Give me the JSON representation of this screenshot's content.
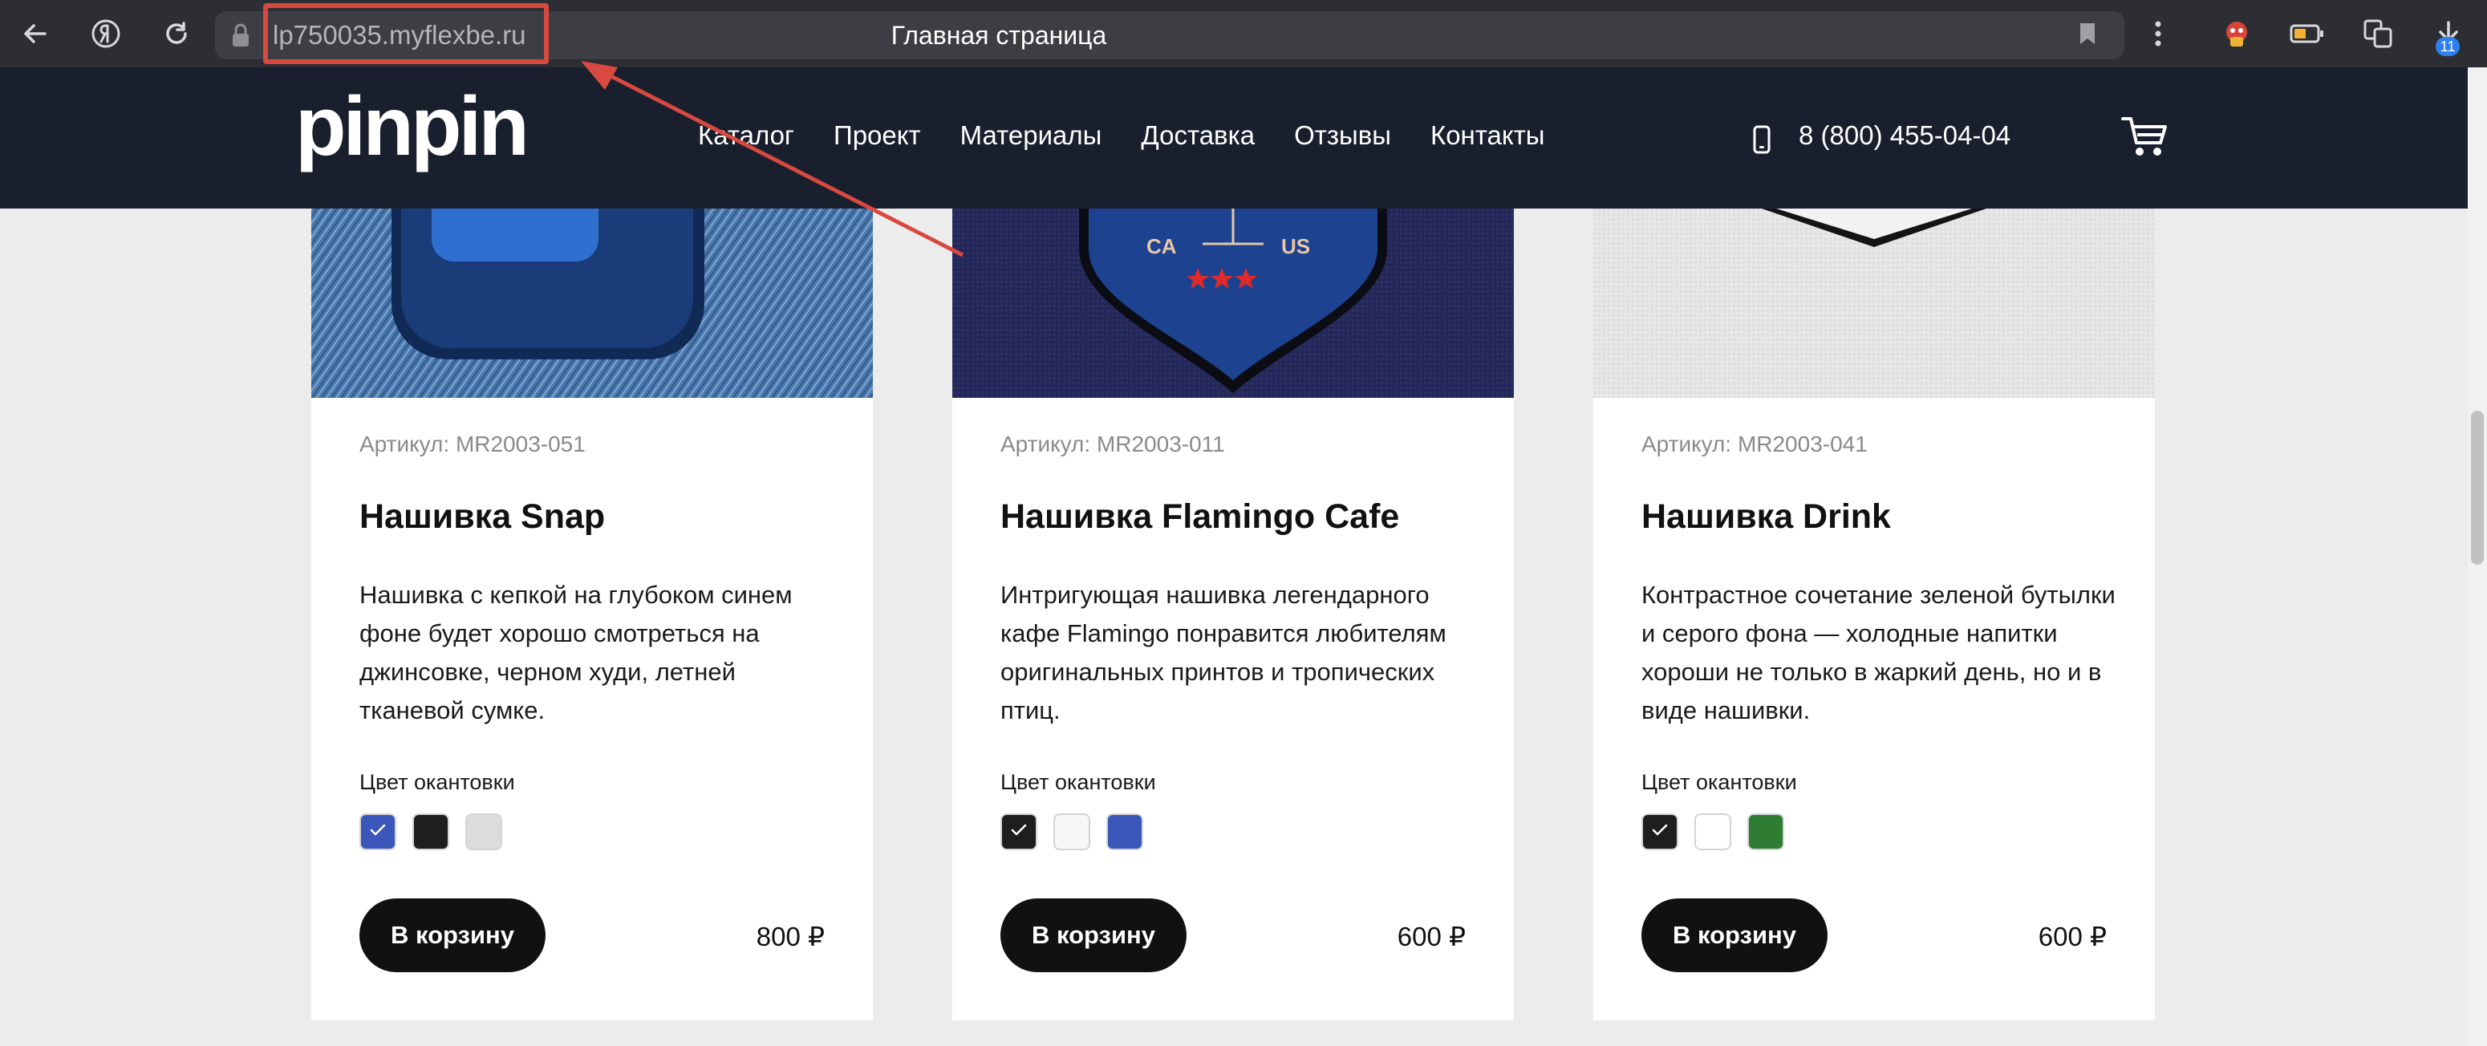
{
  "browser": {
    "url": "lp750035.myflexbe.ru",
    "tab_title": "Главная страница",
    "extension_badge": "11",
    "icons": [
      "back-icon",
      "yandex-icon",
      "reload-icon",
      "lock-icon",
      "bookmark-icon",
      "more-icon",
      "extension-icon",
      "battery-icon",
      "reader-icon",
      "downloads-icon"
    ]
  },
  "header": {
    "logo": "pinpin",
    "nav": [
      "Каталог",
      "Проект",
      "Материалы",
      "Доставка",
      "Отзывы",
      "Контакты"
    ],
    "phone": "8 (800) 455-04-04"
  },
  "products": [
    {
      "sku": "Артикул: MR2003-051",
      "name": "Нашивка Snap",
      "description": "Нашивка с кепкой на глубоком синем фоне будет хорошо смотреться на джинсовке, черном худи, летней тканевой сумке.",
      "color_label": "Цвет окантовки",
      "swatches": [
        "#3a56b8",
        "#1e1e1e",
        "#dcdcdc"
      ],
      "selected_swatch": 0,
      "button": "В корзину",
      "price": "800 ₽"
    },
    {
      "sku": "Артикул: MR2003-011",
      "name": "Нашивка Flamingo Cafe",
      "description": "Интригующая нашивка легендарного кафе Flamingo понравится любителям оригинальных принтов и тропических птиц.",
      "color_label": "Цвет окантовки",
      "swatches": [
        "#1e1e1e",
        "#f6f7f7",
        "#3a56b8"
      ],
      "selected_swatch": 0,
      "button": "В корзину",
      "price": "600 ₽",
      "patch_text": [
        "CA",
        "US"
      ]
    },
    {
      "sku": "Артикул: MR2003-041",
      "name": "Нашивка Drink",
      "description": "Контрастное сочетание зеленой бутылки и серого фона — холодные напитки хороши не только в жаркий день, но и в виде нашивки.",
      "color_label": "Цвет окантовки",
      "swatches": [
        "#1e1e1e",
        "#ffffff",
        "#2e7d32"
      ],
      "selected_swatch": 0,
      "button": "В корзину",
      "price": "600 ₽"
    }
  ],
  "colors": {
    "header_bg": "#1a1f2e",
    "browser_bg": "#2d2e33",
    "highlight": "#d8493f"
  }
}
